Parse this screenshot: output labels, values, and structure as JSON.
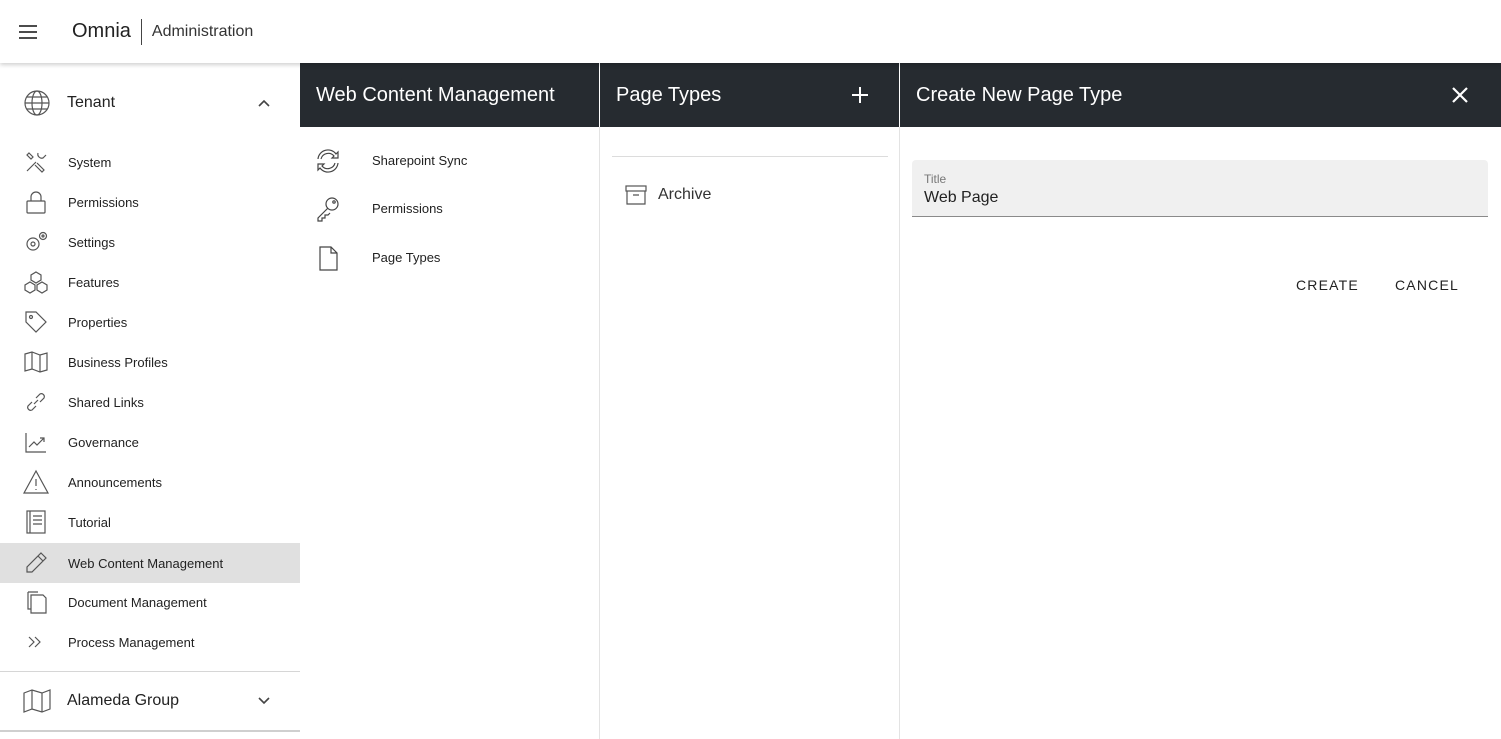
{
  "topbar": {
    "app_name": "Omnia",
    "section": "Administration",
    "menu_icon": "menu-icon"
  },
  "sidebar": {
    "tenant": {
      "label": "Tenant",
      "icon": "globe-icon",
      "expanded": true
    },
    "items": [
      {
        "label": "System",
        "icon": "tools-icon"
      },
      {
        "label": "Permissions",
        "icon": "lock-icon"
      },
      {
        "label": "Settings",
        "icon": "gears-icon"
      },
      {
        "label": "Features",
        "icon": "cubes-icon"
      },
      {
        "label": "Properties",
        "icon": "tag-icon"
      },
      {
        "label": "Business Profiles",
        "icon": "map-icon"
      },
      {
        "label": "Shared Links",
        "icon": "link-icon"
      },
      {
        "label": "Governance",
        "icon": "chart-line-icon"
      },
      {
        "label": "Announcements",
        "icon": "warning-icon"
      },
      {
        "label": "Tutorial",
        "icon": "book-icon"
      },
      {
        "label": "Web Content Management",
        "icon": "pencil-icon",
        "active": true
      },
      {
        "label": "Document Management",
        "icon": "copy-icon"
      },
      {
        "label": "Process Management",
        "icon": "double-chevron-icon"
      }
    ],
    "alameda": {
      "label": "Alameda Group",
      "icon": "map-icon",
      "expanded": false
    }
  },
  "wcm_panel": {
    "title": "Web Content Management",
    "items": [
      {
        "label": "Sharepoint Sync",
        "icon": "sync-icon"
      },
      {
        "label": "Permissions",
        "icon": "key-icon"
      },
      {
        "label": "Page Types",
        "icon": "file-icon"
      }
    ]
  },
  "page_types_panel": {
    "title": "Page Types",
    "add_icon": "plus-icon",
    "items": [
      {
        "label": "Archive",
        "icon": "archive-icon"
      }
    ]
  },
  "create_panel": {
    "title": "Create New Page Type",
    "close_icon": "close-icon",
    "title_field": {
      "label": "Title",
      "value": "Web Page"
    },
    "create_label": "CREATE",
    "cancel_label": "CANCEL"
  },
  "colors": {
    "header_bg": "#262b30",
    "active_bg": "#e0e0e0",
    "field_bg": "#f0f0f0"
  }
}
